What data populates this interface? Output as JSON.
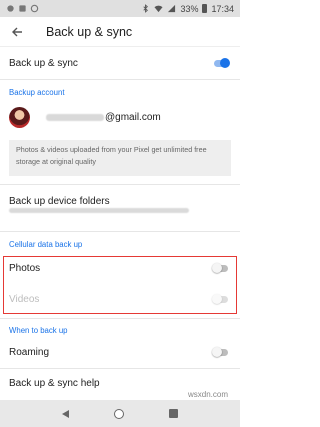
{
  "status_bar": {
    "time": "17:34",
    "battery": "33%"
  },
  "app_bar": {
    "title": "Back up & sync"
  },
  "backup_sync": {
    "label": "Back up & sync",
    "enabled": true
  },
  "backup_account": {
    "section_title": "Backup account",
    "email_suffix": "@gmail.com"
  },
  "info": {
    "text": "Photos & videos uploaded from your Pixel get unlimited free storage at original quality"
  },
  "device_folders": {
    "label": "Back up device folders"
  },
  "cellular": {
    "section_title": "Cellular data back up",
    "photos_label": "Photos",
    "photos_enabled": false,
    "videos_label": "Videos",
    "videos_enabled": false
  },
  "when_to_backup": {
    "section_title": "When to back up",
    "roaming_label": "Roaming",
    "roaming_enabled": false
  },
  "help": {
    "label": "Back up & sync help"
  },
  "watermark": "wsxdn.com"
}
